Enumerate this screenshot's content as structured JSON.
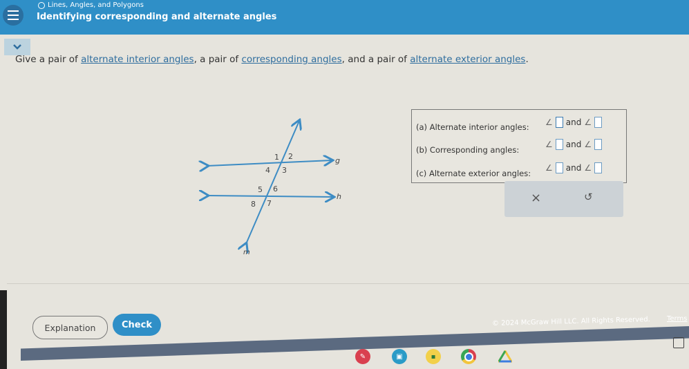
{
  "header": {
    "breadcrumb": "Lines, Angles, and Polygons",
    "title": "Identifying corresponding and alternate angles"
  },
  "prompt": {
    "part1": "Give a pair of ",
    "link1": "alternate interior angles",
    "part2": ", a pair of ",
    "link2": "corresponding angles",
    "part3": ", and a pair of ",
    "link3": "alternate exterior angles",
    "part4": "."
  },
  "figure": {
    "angle_labels": [
      "1",
      "2",
      "3",
      "4",
      "5",
      "6",
      "7",
      "8"
    ],
    "line_labels": {
      "g": "g",
      "h": "h",
      "m": "m"
    },
    "color": "#3d8cc4"
  },
  "answers": {
    "rows": [
      {
        "label": "(a) Alternate interior angles:",
        "connector": "and",
        "value1": "",
        "value2": ""
      },
      {
        "label": "(b) Corresponding angles:",
        "connector": "and",
        "value1": "",
        "value2": ""
      },
      {
        "label": "(c) Alternate exterior angles:",
        "connector": "and",
        "value1": "",
        "value2": ""
      }
    ],
    "angle_symbol": "∠",
    "clear_symbol": "×",
    "undo_symbol": "↺"
  },
  "buttons": {
    "explanation": "Explanation",
    "check": "Check"
  },
  "footer": {
    "copyright": "© 2024 McGraw Hill LLC. All Rights Reserved.",
    "terms": "Terms"
  },
  "shelf": {
    "apps": [
      {
        "name": "paint-app",
        "color": "#d9404f"
      },
      {
        "name": "meet-app",
        "color": "#2a9bc7"
      },
      {
        "name": "classroom-app",
        "color": "#f2d04a"
      },
      {
        "name": "chrome-app",
        "color": "#3b7de0"
      },
      {
        "name": "drive-app",
        "color": "#ffffff"
      }
    ]
  },
  "colors": {
    "brand": "#2f8fc7",
    "link": "#2e6d9e",
    "footer_band": "#5b6a80"
  }
}
